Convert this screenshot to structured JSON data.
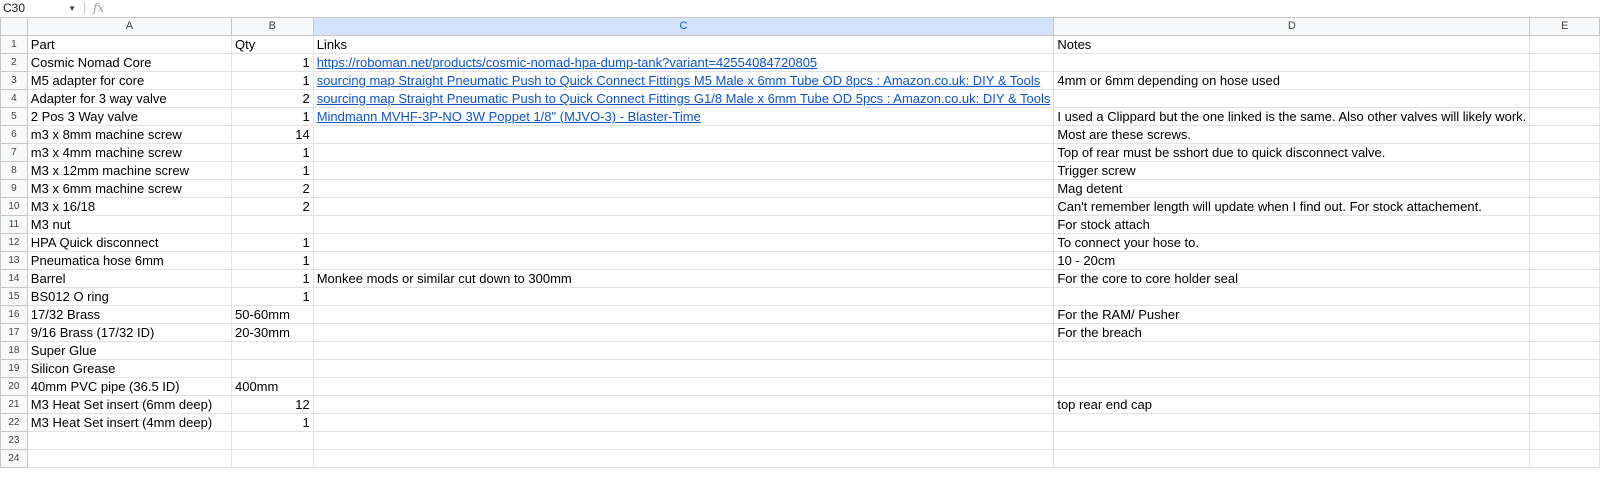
{
  "formula_bar": {
    "cell_ref": "C30",
    "fx_label": "fx",
    "value": ""
  },
  "columns": [
    "A",
    "B",
    "C",
    "D",
    "E"
  ],
  "rows": [
    {
      "n": "1",
      "part": "Part",
      "qty": "Qty",
      "link": "Links",
      "notes": "Notes"
    },
    {
      "n": "2",
      "part": "Cosmic Nomad Core",
      "qty": "1",
      "link": "https://roboman.net/products/cosmic-nomad-hpa-dump-tank?variant=42554084720805",
      "notes": ""
    },
    {
      "n": "3",
      "part": "M5 adapter for core",
      "qty": "1",
      "link": "sourcing map Straight Pneumatic Push to Quick Connect Fittings M5 Male x 6mm Tube OD 8pcs : Amazon.co.uk: DIY & Tools",
      "notes": "4mm or 6mm depending on hose used"
    },
    {
      "n": "4",
      "part": "Adapter for 3 way valve",
      "qty": "2",
      "link": "sourcing map Straight Pneumatic Push to Quick Connect Fittings G1/8 Male x 6mm Tube OD 5pcs : Amazon.co.uk: DIY & Tools",
      "notes": ""
    },
    {
      "n": "5",
      "part": "2 Pos 3 Way valve",
      "qty": "1",
      "link": "Mindmann MVHF-3P-NO 3W Poppet 1/8\" (MJVO-3) - Blaster-Time",
      "notes": "I used a Clippard but the one linked is the same. Also other valves will likely work."
    },
    {
      "n": "6",
      "part": "m3 x 8mm machine screw",
      "qty": "14",
      "link": "",
      "notes": "Most are these screws."
    },
    {
      "n": "7",
      "part": "m3 x 4mm machine screw",
      "qty": "1",
      "link": "",
      "notes": "Top of rear must be sshort due to quick disconnect valve."
    },
    {
      "n": "8",
      "part": "M3 x 12mm machine screw",
      "qty": "1",
      "link": "",
      "notes": "Trigger screw"
    },
    {
      "n": "9",
      "part": "M3 x 6mm machine screw",
      "qty": "2",
      "link": "",
      "notes": "Mag detent"
    },
    {
      "n": "10",
      "part": "M3 x 16/18",
      "qty": "2",
      "link": "",
      "notes": "Can't remember length will update when I find out. For stock attachement."
    },
    {
      "n": "11",
      "part": "M3 nut",
      "qty": "",
      "link": "",
      "notes": "For stock attach"
    },
    {
      "n": "12",
      "part": "HPA Quick disconnect",
      "qty": "1",
      "link": "",
      "notes": "To connect your hose to."
    },
    {
      "n": "13",
      "part": "Pneumatica hose 6mm",
      "qty": "1",
      "link": "",
      "notes": "10 - 20cm"
    },
    {
      "n": "14",
      "part": "Barrel",
      "qty": "1",
      "link": "Monkee mods or similar cut down to 300mm",
      "notes": "For the core to core holder seal"
    },
    {
      "n": "15",
      "part": "BS012 O ring",
      "qty": "1",
      "link": "",
      "notes": ""
    },
    {
      "n": "16",
      "part": "17/32 Brass",
      "qty": "50-60mm",
      "link": "",
      "notes": "For the RAM/ Pusher"
    },
    {
      "n": "17",
      "part": "9/16 Brass (17/32 ID)",
      "qty": "20-30mm",
      "link": "",
      "notes": "For the breach"
    },
    {
      "n": "18",
      "part": "Super Glue",
      "qty": "",
      "link": "",
      "notes": ""
    },
    {
      "n": "19",
      "part": "Silicon Grease",
      "qty": "",
      "link": "",
      "notes": ""
    },
    {
      "n": "20",
      "part": "40mm PVC pipe (36.5 ID)",
      "qty": "400mm",
      "link": "",
      "notes": ""
    },
    {
      "n": "21",
      "part": "M3 Heat Set insert (6mm deep)",
      "qty": "12",
      "link": "",
      "notes": "top rear end cap"
    },
    {
      "n": "22",
      "part": "M3 Heat Set insert (4mm deep)",
      "qty": "1",
      "link": "",
      "notes": ""
    },
    {
      "n": "23",
      "part": "",
      "qty": "",
      "link": "",
      "notes": ""
    },
    {
      "n": "24",
      "part": "",
      "qty": "",
      "link": "",
      "notes": ""
    }
  ],
  "colors": {
    "link": "#1155cc",
    "selected_header": "#d3e3fd",
    "header_bg": "#f8f9fa",
    "grid": "#e2e3e3"
  }
}
